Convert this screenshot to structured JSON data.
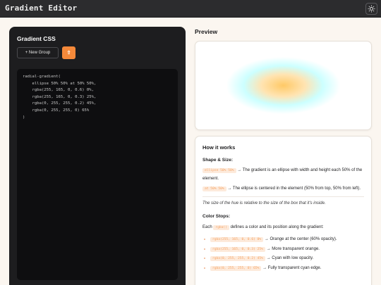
{
  "app": {
    "title": "Gradient Editor",
    "theme_icon": "sun-icon"
  },
  "left": {
    "title": "Gradient CSS",
    "new_group_label": "+ New Group",
    "export_label": "⇧",
    "code": "radial-gradient(\n    ellipse 50% 50% at 50% 50%,\n    rgba(255, 165, 0, 0.6) 0%,\n    rgba(255, 165, 0, 0.3) 25%,\n    rgba(0, 255, 255, 0.2) 45%,\n    rgba(0, 255, 255, 0) 65%\n)"
  },
  "preview": {
    "title": "Preview",
    "gradient": {
      "shape": "ellipse",
      "size": "50% 50%",
      "position": "50% 50%",
      "stops": [
        {
          "color": "rgba(255, 165, 0, 0.6)",
          "pos": 0
        },
        {
          "color": "rgba(255, 165, 0, 0.3)",
          "pos": 25
        },
        {
          "color": "rgba(0, 255, 255, 0.2)",
          "pos": 45
        },
        {
          "color": "rgba(0, 255, 255, 0)",
          "pos": 65
        }
      ]
    }
  },
  "info": {
    "title": "How it works",
    "shape_heading": "Shape & Size:",
    "shape_code": "ellipse 50% 50%",
    "shape_text": "→ The gradient is an ellipse with width and height each 50% of the element.",
    "pos_code": "at 50% 50%",
    "pos_text": "→ The ellipse is centered in the element (50% from top, 50% from left).",
    "note": "The size of the hue is relative to the size of the box that it's inside.",
    "stops_heading": "Color Stops:",
    "stops_intro_pre": "Each",
    "stops_intro_code": "rgba()",
    "stops_intro_post": "defines a color and its position along the gradient:",
    "stops": [
      {
        "code": "rgba(255, 165, 0, 0.6) 0%",
        "text": "→ Orange at the center (60% opacity)."
      },
      {
        "code": "rgba(255, 165, 0, 0.3) 25%",
        "text": "→ More transparent orange."
      },
      {
        "code": "rgba(0, 255, 255, 0.2) 45%",
        "text": "→ Cyan with low opacity."
      },
      {
        "code": "rgba(0, 255, 255, 0) 65%",
        "text": "→ Fully transparent cyan edge."
      }
    ]
  },
  "colors": {
    "accent": "#f5893a",
    "topbar": "#2c2c2e",
    "page": "#fbf6f0"
  }
}
